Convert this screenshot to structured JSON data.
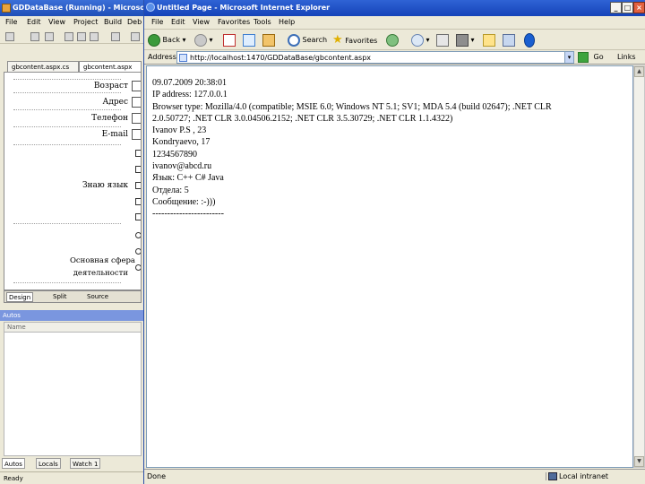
{
  "vs": {
    "title": "GDDataBase (Running) - Microsoft Vi",
    "menu": [
      "File",
      "Edit",
      "View",
      "Project",
      "Build",
      "Deb"
    ],
    "doc_tabs": [
      "gbcontent.aspx.cs",
      "gbcontent.aspx"
    ],
    "form_labels": {
      "age": "Возраст",
      "address": "Адрес",
      "phone": "Телефон",
      "email": "E-mail",
      "languages": "Знаю язык",
      "sphere_line1": "Основная сфера",
      "sphere_line2": "деятельности"
    },
    "view_tabs": [
      "Design",
      "Split",
      "Source"
    ],
    "autos_title": "Autos",
    "autos_col_name": "Name",
    "bottom_tabs": [
      "Autos",
      "Locals",
      "Watch 1"
    ],
    "status": "Ready"
  },
  "ie": {
    "title": "Untitled Page - Microsoft Internet Explorer",
    "menu": [
      "File",
      "Edit",
      "View",
      "Favorites",
      "Tools",
      "Help"
    ],
    "toolbar": {
      "back": "Back",
      "search": "Search",
      "favorites": "Favorites"
    },
    "address_label": "Address",
    "address_url": "http://localhost:1470/GDDataBase/gbcontent.aspx",
    "go_label": "Go",
    "links_label": "Links",
    "status_text": "Done",
    "status_zone": "Local intranet",
    "content_lines": [
      "09.07.2009 20:38:01",
      "IP address: 127.0.0.1",
      "Browser type: Mozilla/4.0 (compatible; MSIE 6.0; Windows NT 5.1; SV1; MDA 5.4 (build 02647); .NET CLR",
      "2.0.50727; .NET CLR 3.0.04506.2152; .NET CLR 3.5.30729; .NET CLR 1.1.4322)",
      "Ivanov P.S , 23",
      "Kondryaevo, 17",
      "1234567890",
      "ivanov@abcd.ru",
      "Язык: C++ C# Java",
      "Отдела: 5",
      "Сообщение: :-)))",
      "------------------------"
    ]
  }
}
